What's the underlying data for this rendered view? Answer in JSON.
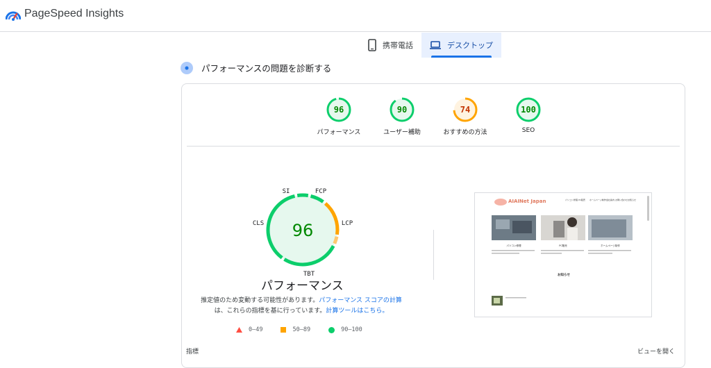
{
  "header": {
    "title": "PageSpeed Insights"
  },
  "tabs": [
    {
      "label": "携帯電話",
      "icon": "phone-icon",
      "active": false
    },
    {
      "label": "デスクトップ",
      "icon": "laptop-icon",
      "active": true
    }
  ],
  "diagnose": {
    "heading": "パフォーマンスの問題を診断する"
  },
  "scores": [
    {
      "value": "96",
      "label": "パフォーマンス",
      "color": "#0cce6b"
    },
    {
      "value": "90",
      "label": "ユーザー補助",
      "color": "#0cce6b"
    },
    {
      "value": "74",
      "label": "おすすめの方法",
      "color": "#ffa400"
    },
    {
      "value": "100",
      "label": "SEO",
      "color": "#0cce6b"
    }
  ],
  "main_gauge": {
    "score": "96",
    "title": "パフォーマンス",
    "metric_labels": {
      "si": "SI",
      "fcp": "FCP",
      "lcp": "LCP",
      "tbt": "TBT",
      "cls": "CLS"
    }
  },
  "note": {
    "text1": "推定値のため変動する可能性があります。",
    "link1": "パフォーマンス スコアの計算",
    "text2": "は、これらの指標を基に行っています。",
    "link2": "計算ツールはこちら。"
  },
  "legend": [
    {
      "range": "0–49",
      "color": "#ff4e42",
      "shape": "triangle"
    },
    {
      "range": "50–89",
      "color": "#ffa400",
      "shape": "square"
    },
    {
      "range": "90–100",
      "color": "#0cce6b",
      "shape": "circle"
    }
  ],
  "screenshot": {
    "site_name": "AIAINet Japan",
    "nav": [
      "パソコン修理",
      "PC販売",
      "ホームページ制作",
      "会社案内",
      "お問い合わせ",
      "お知らせ"
    ],
    "cards": [
      "パソコン修理",
      "PC販売",
      "ホームページ制作"
    ],
    "section": "お知らせ"
  },
  "footer": {
    "metrics_label": "指標",
    "view_link": "ビューを開く"
  }
}
